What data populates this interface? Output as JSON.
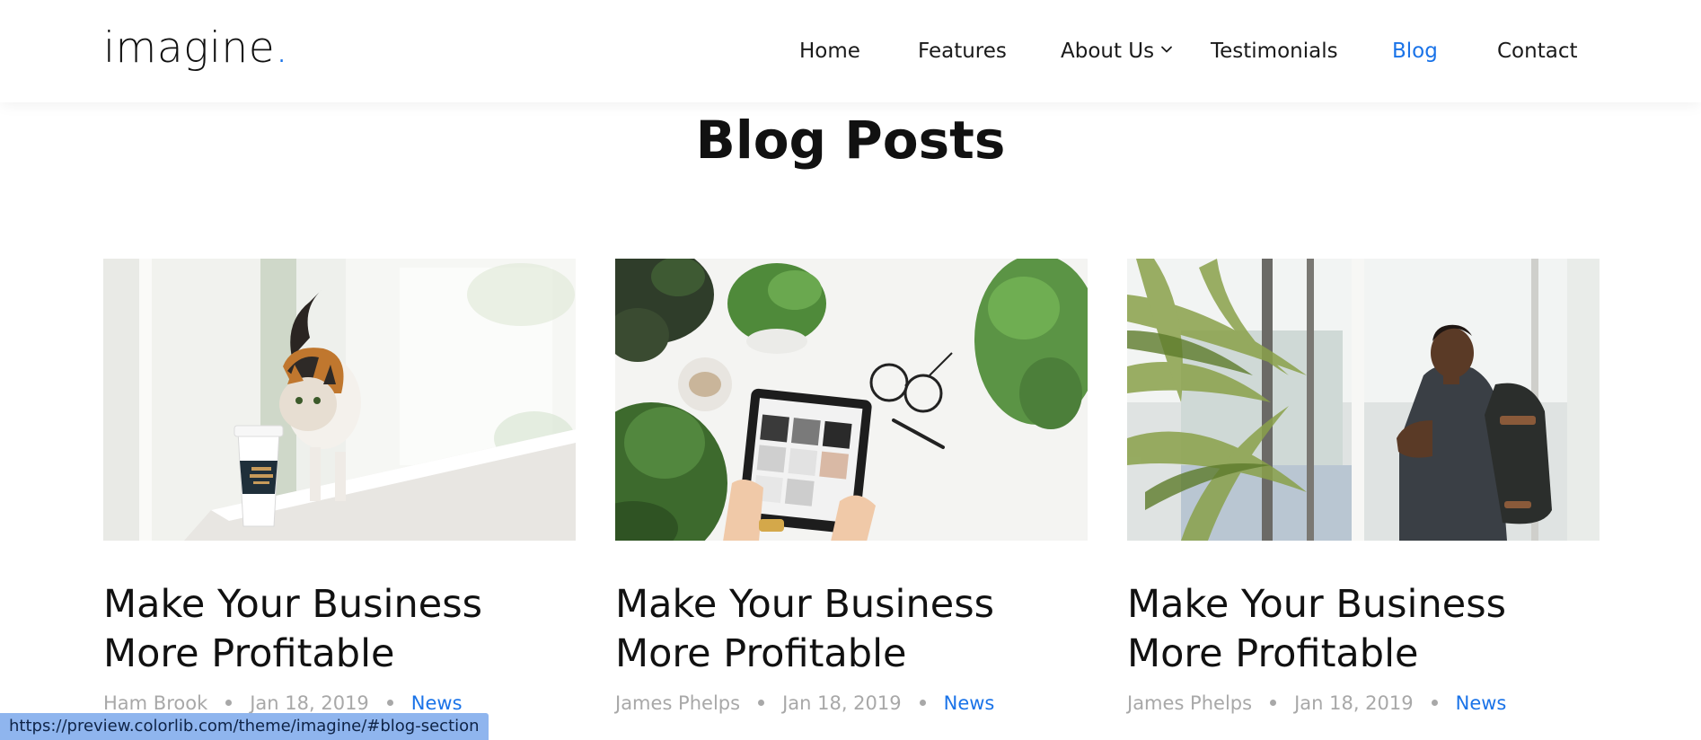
{
  "brand": {
    "name": "imagine",
    "dot": "."
  },
  "nav": {
    "items": [
      {
        "label": "Home"
      },
      {
        "label": "Features"
      },
      {
        "label": "About Us"
      },
      {
        "label": "Testimonials"
      },
      {
        "label": "Blog"
      },
      {
        "label": "Contact"
      }
    ],
    "active": "Blog"
  },
  "section": {
    "title": "Blog Posts"
  },
  "posts": [
    {
      "title": "Make Your Business More Profitable",
      "author": "Ham Brook",
      "date": "Jan 18, 2019",
      "category": "News",
      "image": "cat-with-coffee-cup-photo"
    },
    {
      "title": "Make Your Business More Profitable",
      "author": "James Phelps",
      "date": "Jan 18, 2019",
      "category": "News",
      "image": "tablet-and-plants-photo"
    },
    {
      "title": "Make Your Business More Profitable",
      "author": "James Phelps",
      "date": "Jan 18, 2019",
      "category": "News",
      "image": "man-with-backpack-photo"
    }
  ],
  "status_bar": {
    "url": "https://preview.colorlib.com/theme/imagine/#blog-section"
  },
  "colors": {
    "accent": "#1a73e8",
    "text": "#111111",
    "meta": "#a8a8a8",
    "status_bg": "#8fb5ee"
  }
}
